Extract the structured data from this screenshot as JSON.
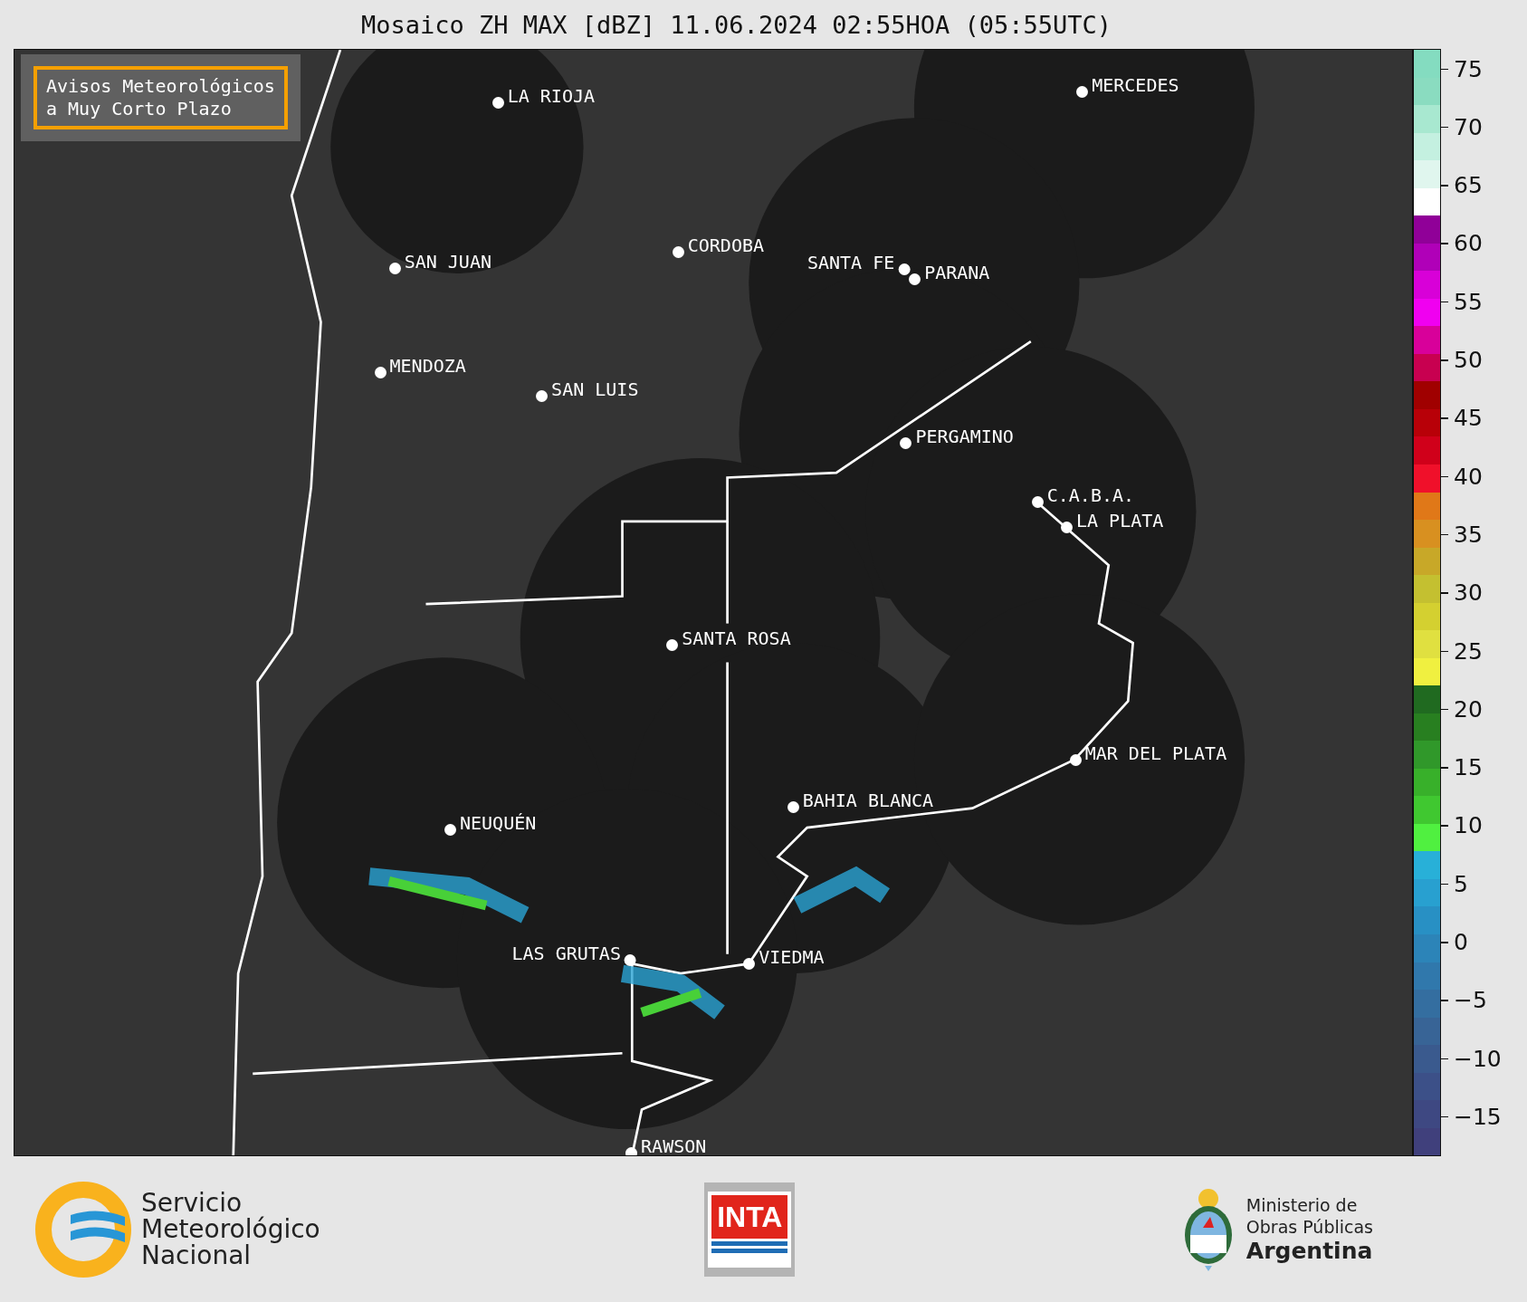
{
  "title": "Mosaico ZH MAX [dBZ] 11.06.2024 02:55HOA (05:55UTC)",
  "notice": "Avisos Meteorológicos\na Muy Corto Plazo",
  "cities": [
    {
      "name": "LA RIOJA"
    },
    {
      "name": "MERCEDES"
    },
    {
      "name": "CORDOBA"
    },
    {
      "name": "SAN JUAN"
    },
    {
      "name": "SANTA FE"
    },
    {
      "name": "PARANA"
    },
    {
      "name": "MENDOZA"
    },
    {
      "name": "SAN LUIS"
    },
    {
      "name": "PERGAMINO"
    },
    {
      "name": "C.A.B.A."
    },
    {
      "name": "LA PLATA"
    },
    {
      "name": "SANTA ROSA"
    },
    {
      "name": "MAR DEL PLATA"
    },
    {
      "name": "BAHIA BLANCA"
    },
    {
      "name": "NEUQUÉN"
    },
    {
      "name": "LAS GRUTAS"
    },
    {
      "name": "VIEDMA"
    },
    {
      "name": "RAWSON"
    }
  ],
  "colorbar_ticks": [
    "75",
    "70",
    "65",
    "60",
    "55",
    "50",
    "45",
    "40",
    "35",
    "30",
    "25",
    "20",
    "15",
    "10",
    "5",
    "0",
    "−5",
    "−10",
    "−15"
  ],
  "footer": {
    "smn": [
      "Servicio",
      "Meteorológico",
      "Nacional"
    ],
    "inta": "INTA",
    "ministry": [
      "Ministerio de",
      "Obras Públicas",
      "Argentina"
    ]
  }
}
